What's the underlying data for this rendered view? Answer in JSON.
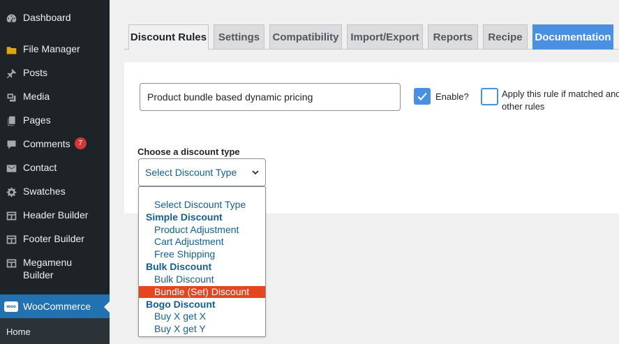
{
  "sidebar": {
    "items": [
      {
        "label": "Dashboard",
        "icon": "dashboard-icon"
      },
      {
        "label": "File Manager",
        "icon": "folder-icon"
      },
      {
        "label": "Posts",
        "icon": "pin-icon"
      },
      {
        "label": "Media",
        "icon": "media-icon"
      },
      {
        "label": "Pages",
        "icon": "pages-icon"
      },
      {
        "label": "Comments",
        "icon": "comment-icon",
        "badge": "7"
      },
      {
        "label": "Contact",
        "icon": "mail-icon"
      },
      {
        "label": "Swatches",
        "icon": "gear-icon"
      },
      {
        "label": "Header Builder",
        "icon": "layout-icon"
      },
      {
        "label": "Footer Builder",
        "icon": "layout-icon"
      },
      {
        "label": "Megamenu Builder",
        "icon": "layout-icon"
      },
      {
        "label": "WooCommerce",
        "icon": "woo-icon",
        "logo_text": "woo"
      }
    ],
    "submenu": {
      "home": "Home"
    }
  },
  "tabs": [
    {
      "label": "Discount Rules"
    },
    {
      "label": "Settings"
    },
    {
      "label": "Compatibility"
    },
    {
      "label": "Import/Export"
    },
    {
      "label": "Reports"
    },
    {
      "label": "Recipe"
    },
    {
      "label": "Documentation"
    }
  ],
  "form": {
    "rule_name": "Product bundle based dynamic pricing",
    "enable_label": "Enable?",
    "enable_checked": true,
    "apply_label": "Apply this rule if matched and",
    "apply_label_2": "other rules",
    "apply_checked": false,
    "type_label": "Choose a discount type",
    "type_value": "Select Discount Type"
  },
  "dropdown": {
    "rows": [
      {
        "kind": "opt",
        "label": "Select Discount Type"
      },
      {
        "kind": "group",
        "label": "Simple Discount"
      },
      {
        "kind": "opt",
        "label": "Product Adjustment"
      },
      {
        "kind": "opt",
        "label": "Cart Adjustment"
      },
      {
        "kind": "opt",
        "label": "Free Shipping"
      },
      {
        "kind": "group",
        "label": "Bulk Discount"
      },
      {
        "kind": "opt",
        "label": "Bulk Discount"
      },
      {
        "kind": "opt",
        "label": "Bundle (Set) Discount",
        "selected": true
      },
      {
        "kind": "group",
        "label": "Bogo Discount"
      },
      {
        "kind": "opt",
        "label": "Buy X get X"
      },
      {
        "kind": "opt",
        "label": "Buy X get Y"
      }
    ]
  },
  "colors": {
    "sidebar_bg": "#1d2327",
    "accent_blue": "#2271b1",
    "doc_tab": "#4a90e2",
    "highlight": "#e6461f",
    "badge": "#d63638"
  }
}
